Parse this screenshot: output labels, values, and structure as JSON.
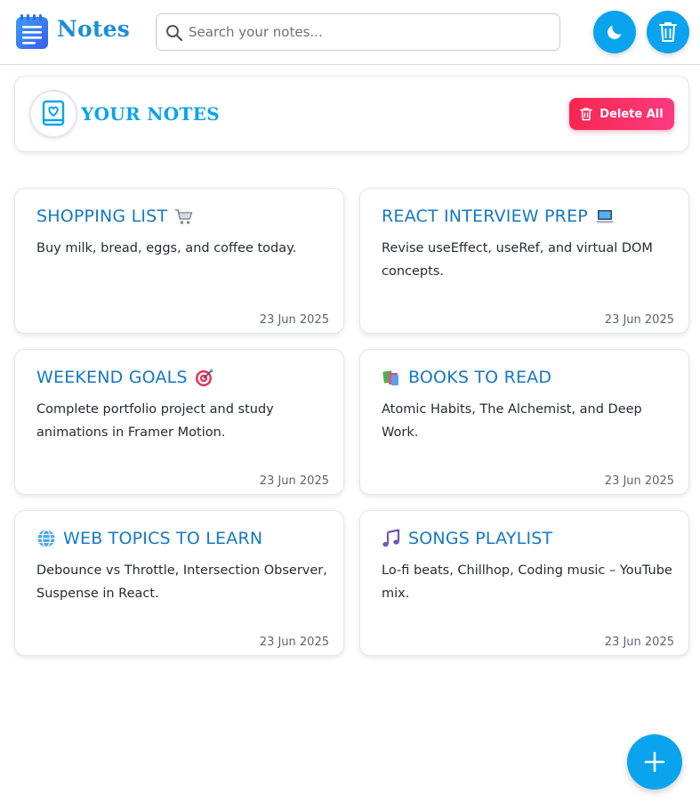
{
  "header": {
    "app_name": "Notes",
    "search_placeholder": "Search your notes...",
    "search_value": "",
    "theme_icon": "moon-icon",
    "trash_icon": "trash-icon"
  },
  "banner": {
    "title": "YOUR NOTES",
    "icon": "book-heart-icon",
    "delete_all_label": "Delete All"
  },
  "notes": [
    {
      "title": "SHOPPING LIST",
      "emoji": "cart-icon",
      "body": "Buy milk, bread, eggs, and coffee today.",
      "date": "23 Jun 2025"
    },
    {
      "title": "REACT INTERVIEW PREP",
      "emoji": "laptop-icon",
      "body": "Revise useEffect, useRef, and virtual DOM concepts.",
      "date": "23 Jun 2025"
    },
    {
      "title": "WEEKEND GOALS",
      "emoji": "target-icon",
      "body": "Complete portfolio project and study animations in Framer Motion.",
      "date": "23 Jun 2025"
    },
    {
      "title": "BOOKS TO READ",
      "emoji": "books-icon",
      "body": "Atomic Habits, The Alchemist, and Deep Work.",
      "date": "23 Jun 2025"
    },
    {
      "title": "WEB TOPICS TO LEARN",
      "emoji": "globe-icon",
      "body": "Debounce vs Throttle, Intersection Observer, Suspense in React.",
      "date": "23 Jun 2025"
    },
    {
      "title": "SONGS PLAYLIST",
      "emoji": "music-note-icon",
      "body": "Lo-fi beats, Chillhop, Coding music – YouTube mix.",
      "date": "23 Jun 2025"
    }
  ],
  "fab": {
    "icon": "plus-icon"
  },
  "colors": {
    "accent": "#0aa3ee",
    "title_blue": "#1578c5",
    "danger_start": "#f5274f",
    "danger_end": "#fc3b80"
  }
}
